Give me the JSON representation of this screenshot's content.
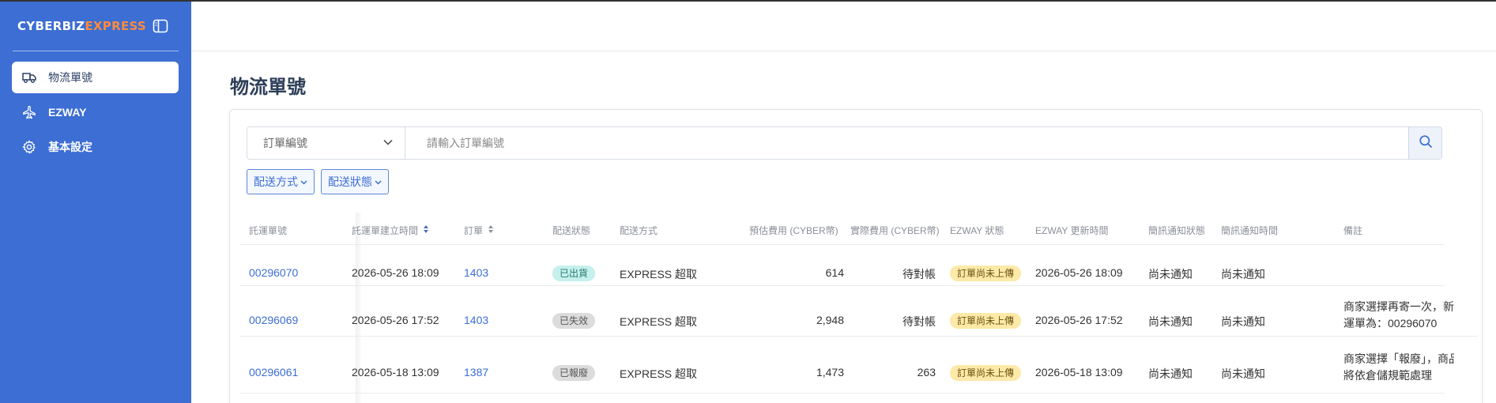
{
  "brand": {
    "part1": "CYBERBIZ",
    "part2": "EXPRESS"
  },
  "colors": {
    "sidebar": "#3c6ed3",
    "brand_accent": "#ff8a3c",
    "link": "#3c6ed3"
  },
  "sidebar": {
    "items": [
      {
        "label": "物流單號",
        "icon": "truck-icon",
        "active": true
      },
      {
        "label": "EZWAY",
        "icon": "plane-icon",
        "active": false
      },
      {
        "label": "基本設定",
        "icon": "gear-icon",
        "active": false
      }
    ]
  },
  "page": {
    "title": "物流單號"
  },
  "search": {
    "select_value": "訂單編號",
    "placeholder": "請輸入訂單編號",
    "icon": "search-icon"
  },
  "filters": [
    {
      "label": "配送方式"
    },
    {
      "label": "配送狀態"
    }
  ],
  "table": {
    "headers": [
      "託運單號",
      "託運單建立時間",
      "訂單",
      "配送狀態",
      "配送方式",
      "預估費用 (CYBER幣)",
      "實際費用 (CYBER幣)",
      "EZWAY 狀態",
      "EZWAY 更新時間",
      "簡訊通知狀態",
      "簡訊通知時間",
      "備註"
    ],
    "rows": [
      {
        "tracking": "00296070",
        "created": "2026-05-26 18:09",
        "order": "1403",
        "status": "已出貨",
        "status_type": "ok",
        "method": "EXPRESS 超取",
        "est_fee": "614",
        "actual_fee": "待對帳",
        "ezway_status": "訂單尚未上傳",
        "ezway_time": "2026-05-26 18:09",
        "sms_status": "尚未通知",
        "sms_time": "尚未通知",
        "note_line1": "",
        "note_line2": ""
      },
      {
        "tracking": "00296069",
        "created": "2026-05-26 17:52",
        "order": "1403",
        "status": "已失效",
        "status_type": "grey",
        "method": "EXPRESS 超取",
        "est_fee": "2,948",
        "actual_fee": "待對帳",
        "ezway_status": "訂單尚未上傳",
        "ezway_time": "2026-05-26 17:52",
        "sms_status": "尚未通知",
        "sms_time": "尚未通知",
        "note_line1": "商家選擇再寄一次，新",
        "note_line2": "運單為：00296070"
      },
      {
        "tracking": "00296061",
        "created": "2026-05-18 13:09",
        "order": "1387",
        "status": "已報廢",
        "status_type": "grey",
        "method": "EXPRESS 超取",
        "est_fee": "1,473",
        "actual_fee": "263",
        "ezway_status": "訂單尚未上傳",
        "ezway_time": "2026-05-18 13:09",
        "sms_status": "尚未通知",
        "sms_time": "尚未通知",
        "note_line1": "商家選擇「報廢」，商品",
        "note_line2": "將依倉儲規範處理"
      }
    ]
  }
}
